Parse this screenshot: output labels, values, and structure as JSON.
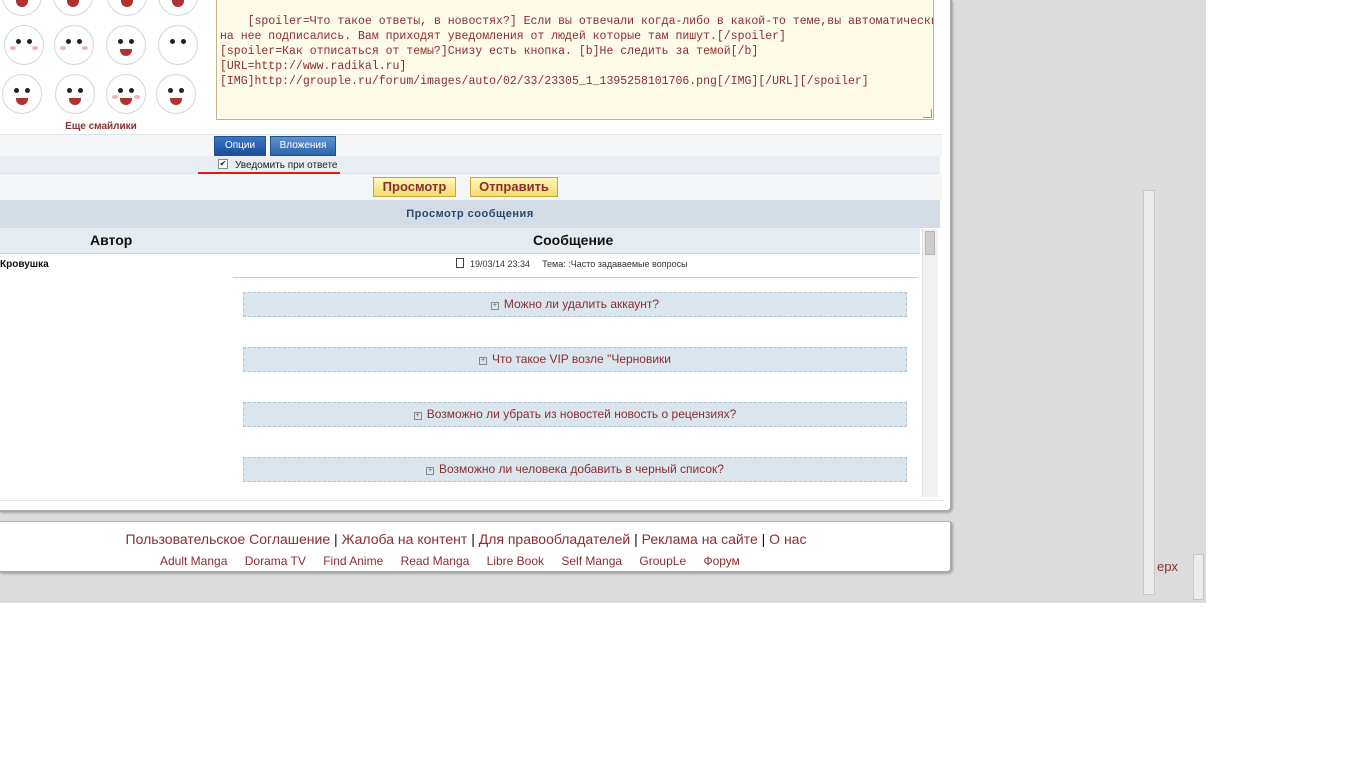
{
  "smileys": {
    "icons": [
      "smiley-01-icon",
      "smiley-02-icon",
      "smiley-03-icon",
      "smiley-04-icon",
      "smiley-05-icon",
      "smiley-06-icon",
      "smiley-07-icon",
      "smiley-08-icon",
      "smiley-09-icon",
      "smiley-10-icon",
      "smiley-11-icon",
      "smiley-12-icon"
    ],
    "more_label": "Еще смайлики"
  },
  "editor": {
    "text": "[spoiler=Что такое ответы, в новостях?] Если вы отвечали когда-либо в какой-то теме,вы автоматически\nна нее подписались. Вам приходят уведомления от людей которые там пишут.[/spoiler]\n[spoiler=Как отписаться от темы?]Снизу есть кнопка. [b]Не следить за темой[/b]\n[URL=http://www.radikal.ru]\n[IMG]http://grouple.ru/forum/images/auto/02/33/23305_1_1395258101706.png[/IMG][/URL][/spoiler]"
  },
  "tabs": {
    "options": "Опции",
    "attachments": "Вложения"
  },
  "notify": {
    "label": "Уведомить при ответе",
    "checked": true
  },
  "buttons": {
    "preview": "Просмотр",
    "submit": "Отправить"
  },
  "preview": {
    "header": "Просмотр сообщения",
    "columns": {
      "author": "Автор",
      "message": "Сообщение"
    },
    "author": "Кровушка",
    "date": "19/03/14 23:34",
    "topic": "Тема: :Часто задаваемые вопросы",
    "spoilers": [
      "Можно ли удалить аккаунт?",
      "Что такое VIP возле \"Черновики",
      "Возможно ли убрать из новостей новость о рецензиях?",
      "Возможно ли человека добавить в черный список?"
    ]
  },
  "footer": {
    "links": [
      "Пользовательское Соглашение",
      "Жалоба на контент",
      "Для правообладателей",
      "Реклама на сайте",
      "О нас"
    ],
    "separator": "|",
    "sites": [
      "Adult Manga",
      "Dorama TV",
      "Find Anime",
      "Read Manga",
      "Libre Book",
      "Self Manga",
      "GroupLe",
      "Форум"
    ]
  },
  "top_link": "ерх",
  "colors": {
    "link": "#8b2e2e",
    "tab_blue": "#2e62a8",
    "button_yellow": "#f2dc6e",
    "header_bg": "#d4dde6",
    "underline_red": "#e01818"
  }
}
